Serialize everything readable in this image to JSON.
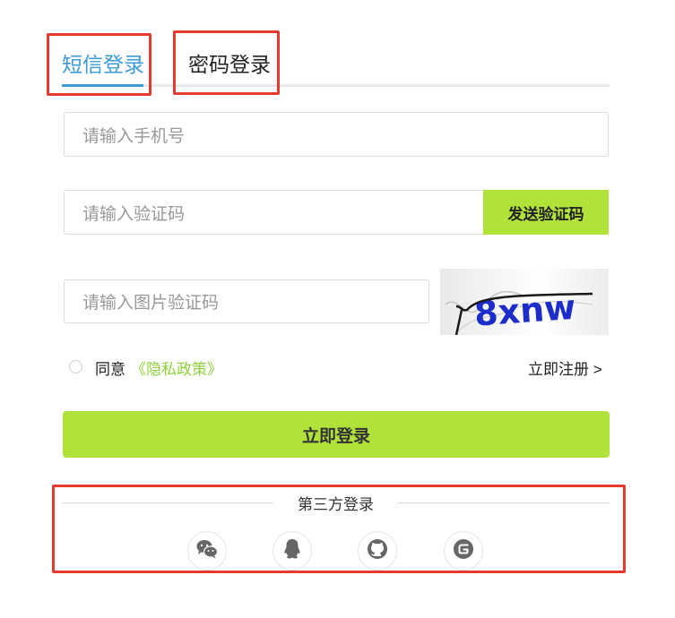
{
  "tabs": {
    "sms_label": "短信登录",
    "password_label": "密码登录"
  },
  "form": {
    "phone_placeholder": "请输入手机号",
    "code_placeholder": "请输入验证码",
    "send_code_label": "发送验证码",
    "image_code_placeholder": "请输入图片验证码",
    "captcha_text": "8xnw"
  },
  "agreement": {
    "agree_text": "同意",
    "privacy_link": "《隐私政策》"
  },
  "register_link": "立即注册 >",
  "login_button": "立即登录",
  "third_party": {
    "title": "第三方登录",
    "providers": [
      "wechat",
      "qq",
      "github",
      "gitee"
    ]
  },
  "colors": {
    "accent_green": "#b1e23a",
    "tab_blue": "#3b9ad8",
    "annotation_red": "#e63a2e"
  }
}
